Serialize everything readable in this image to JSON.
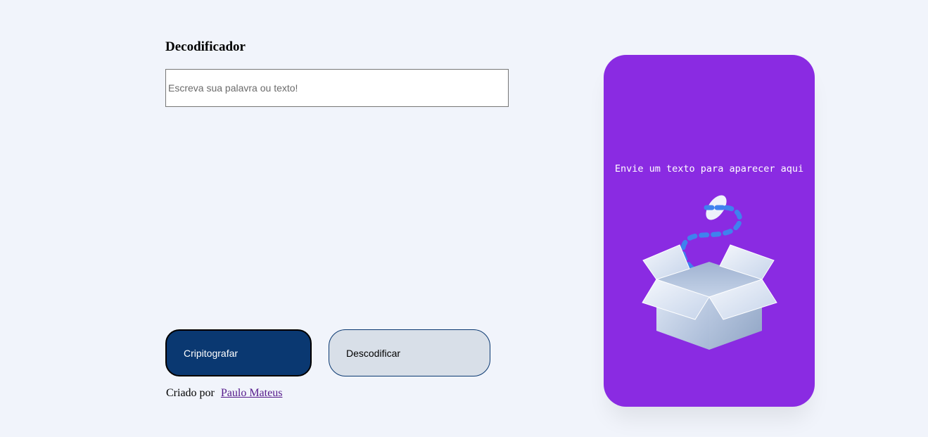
{
  "header": {
    "title": "Decodificador"
  },
  "input": {
    "placeholder": "Escreva sua palavra ou texto!",
    "value": ""
  },
  "actions": {
    "encrypt_label": "Cripitografar",
    "decrypt_label": "Descodificar"
  },
  "footer": {
    "credit_prefix": "Criado por",
    "author_link": "Paulo Mateus"
  },
  "output_card": {
    "message": "Envie um texto para aparecer aqui",
    "illustration_icon": "open-box-icon"
  },
  "colors": {
    "background": "#f1f4fb",
    "card": "#8a2be2",
    "primary_button": "#0a3871",
    "secondary_button": "#d8dfe8",
    "link": "#551a8b"
  }
}
